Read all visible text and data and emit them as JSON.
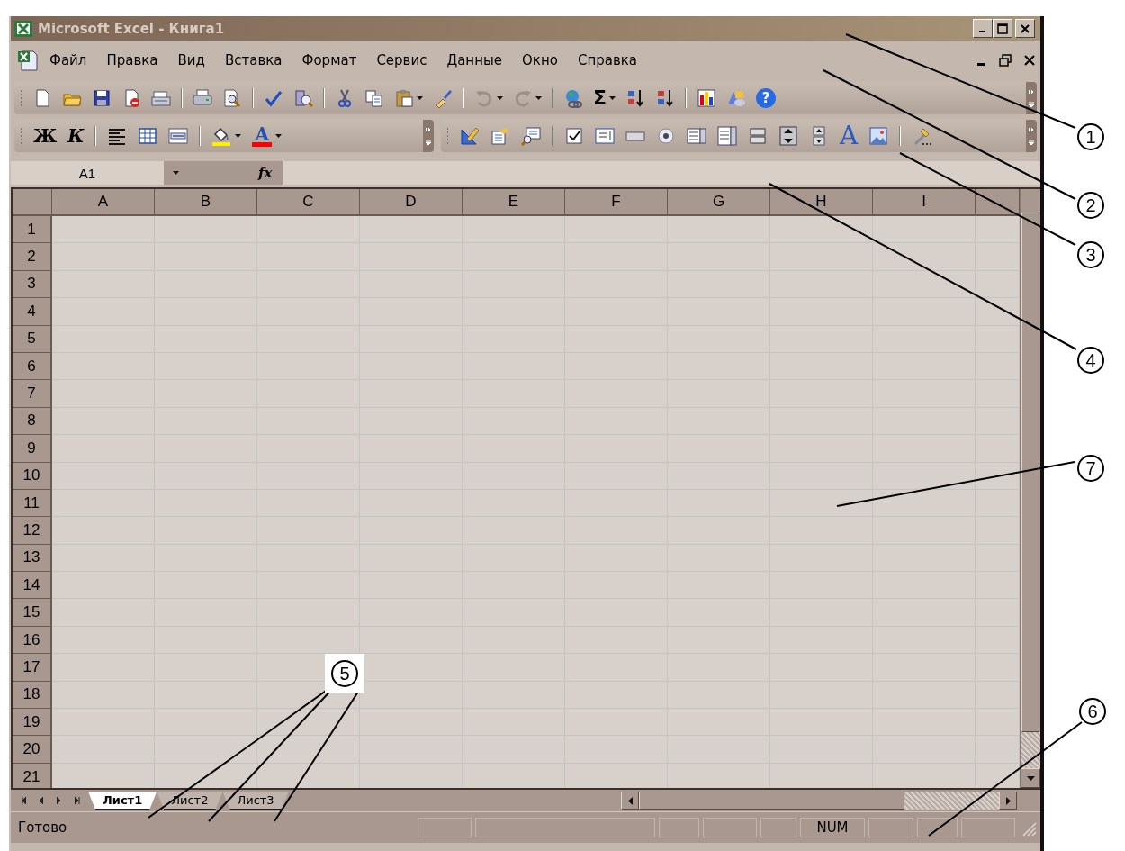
{
  "window": {
    "title": "Microsoft Excel - Книга1"
  },
  "menu": [
    {
      "label": "Файл"
    },
    {
      "label": "Правка"
    },
    {
      "label": "Вид"
    },
    {
      "label": "Вставка"
    },
    {
      "label": "Формат"
    },
    {
      "label": "Сервис"
    },
    {
      "label": "Данные"
    },
    {
      "label": "Окно"
    },
    {
      "label": "Справка"
    }
  ],
  "standard_toolbar": {
    "sum": "Σ",
    "help": "?",
    "undo": {
      "disabled": true
    },
    "redo": {
      "disabled": true
    }
  },
  "formatting_toolbar": {
    "bold": "Ж",
    "italic": "К",
    "font_color": "A"
  },
  "controls_toolbar": {
    "label": "A"
  },
  "formula_bar": {
    "name_box": "A1",
    "function_label": "fx"
  },
  "grid": {
    "columns": [
      "A",
      "B",
      "C",
      "D",
      "E",
      "F",
      "G",
      "H",
      "I"
    ],
    "rows": [
      "1",
      "2",
      "3",
      "4",
      "5",
      "6",
      "7",
      "8",
      "9",
      "10",
      "11",
      "12",
      "13",
      "14",
      "15",
      "16",
      "17",
      "18",
      "19",
      "20",
      "21"
    ]
  },
  "sheet_tabs": [
    {
      "label": "Лист1",
      "selected": true
    },
    {
      "label": "Лист2",
      "selected": false
    },
    {
      "label": "Лист3",
      "selected": false
    }
  ],
  "status_bar": {
    "text": "Готово",
    "indicator": "NUM"
  },
  "callouts": [
    {
      "number": "1"
    },
    {
      "number": "2"
    },
    {
      "number": "3"
    },
    {
      "number": "4"
    },
    {
      "number": "7"
    },
    {
      "number": "5"
    },
    {
      "number": "6"
    }
  ]
}
